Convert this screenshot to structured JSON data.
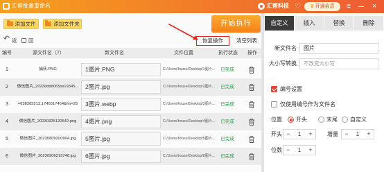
{
  "app": {
    "title": "汇帮批量重命名",
    "user_name": "汇帮科技",
    "vip_label": "开通会员"
  },
  "colors": {
    "header_from": "#f6a01e",
    "header_to": "#ee5b33",
    "accent": "#e8453c",
    "start_button_from": "#fbab2c",
    "start_button_to": "#f5811f",
    "status_success": "#27a349",
    "active_tab": "#3a3a3a",
    "annotation": "#e8231b",
    "add_button": "#ffd964"
  },
  "icons": {
    "logo": "app-logo-icon",
    "avatar": "company-avatar-icon",
    "favorite": "heart-icon",
    "vip": "crown-icon",
    "menu": "menu-icon",
    "minimize": "minimize-icon",
    "close": "close-icon",
    "add": "folder-icon",
    "back": "undo-icon",
    "delete": "trash-icon",
    "stepper_down": "minus-icon",
    "stepper_up": "plus-icon"
  },
  "toolbar": {
    "add_file_label": "添加文件",
    "add_folder_label": "添加文件夹",
    "start_label": "开始执行"
  },
  "subtoolbar": {
    "back_label_1": "返",
    "back_label_2": "回",
    "restore_label": "恢复操作",
    "clear_label": "清空列表"
  },
  "table": {
    "columns": [
      "编号",
      "源文件名（7）",
      "新文件名",
      "文件位置",
      "执行状态",
      "操作"
    ],
    "rows": [
      {
        "index": "1",
        "source": "捕获.PNG",
        "new_name": "1图片.PNG",
        "path": "C:/Users/house/Desktop/1图片...",
        "status": "已完成"
      },
      {
        "index": "2",
        "source": "微信图片_2023dddd065ss19345...",
        "new_name": "2图片.jpg",
        "path": "C:/Users/house/Desktop/2图片...",
        "status": "已完成"
      },
      {
        "index": "3",
        "source": "=638285213,1746517464&fm=25",
        "new_name": "3图片.webp",
        "path": "C:/Users/house/Desktop/3图片...",
        "status": "已完成"
      },
      {
        "index": "4",
        "source": "微信图片_20230325120542.png",
        "new_name": "4图片.png",
        "path": "C:/Users/house/Desktop/4图片...",
        "status": "已完成"
      },
      {
        "index": "5",
        "source": "微信图片_20230809200904.jpg",
        "new_name": "5图片.jpg",
        "path": "C:/Users/house/Desktop/5图片...",
        "status": "已完成"
      },
      {
        "index": "6",
        "source": "微信图片_20230906215748.jpg",
        "new_name": "6图片.jpg",
        "path": "C:/Users/house/Desktop/6图片...",
        "status": "已完成"
      }
    ]
  },
  "panel": {
    "tabs": [
      "自定义",
      "插入",
      "替换",
      "删除"
    ],
    "active_tab": 0,
    "new_name_label": "新文件名",
    "new_name_value": "图片",
    "case_label": "大小写转换",
    "case_value": "不改变大小写",
    "numbering_label": "编号设置",
    "numbering_checked": true,
    "only_number_label": "仅使用编号作为文件名",
    "only_number_checked": false,
    "position_label": "位置",
    "position_options": [
      "开头",
      "末尾",
      "自定义"
    ],
    "position_selected": 0,
    "start_label": "开头",
    "start_value": "1",
    "increment_label": "增量",
    "increment_value": "1",
    "digits_label": "位数",
    "digits_value": "1"
  }
}
